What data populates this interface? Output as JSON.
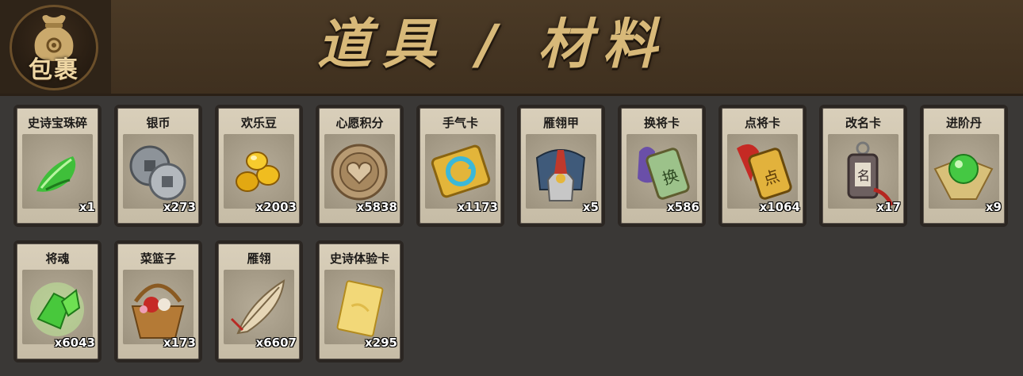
{
  "header": {
    "logo_text": "包裹",
    "title": "道具 / 材料"
  },
  "colors": {
    "header_bg": "#4b3a26",
    "title_text": "#d8b979",
    "card_bg": "#d9cfba",
    "page_bg": "#3a3836"
  },
  "items": [
    {
      "name": "史诗宝珠碎",
      "count": "x1",
      "icon": "green-jade-shard-icon"
    },
    {
      "name": "银币",
      "count": "x273",
      "icon": "silver-coin-icon"
    },
    {
      "name": "欢乐豆",
      "count": "x2003",
      "icon": "golden-bean-icon"
    },
    {
      "name": "心愿积分",
      "count": "x5838",
      "icon": "heart-coin-icon"
    },
    {
      "name": "手气卡",
      "count": "x1173",
      "icon": "luck-card-icon"
    },
    {
      "name": "雁翎甲",
      "count": "x5",
      "icon": "armor-helmet-icon"
    },
    {
      "name": "换将卡",
      "count": "x586",
      "icon": "swap-general-card-icon"
    },
    {
      "name": "点将卡",
      "count": "x1064",
      "icon": "select-general-card-icon"
    },
    {
      "name": "改名卡",
      "count": "x17",
      "icon": "rename-card-icon"
    },
    {
      "name": "进阶丹",
      "count": "x9",
      "icon": "green-pill-icon"
    },
    {
      "name": "将魂",
      "count": "x6043",
      "icon": "green-crystal-icon"
    },
    {
      "name": "菜篮子",
      "count": "x173",
      "icon": "basket-icon"
    },
    {
      "name": "雁翎",
      "count": "x6607",
      "icon": "feather-icon"
    },
    {
      "name": "史诗体验卡",
      "count": "x295",
      "icon": "gold-card-icon"
    }
  ]
}
